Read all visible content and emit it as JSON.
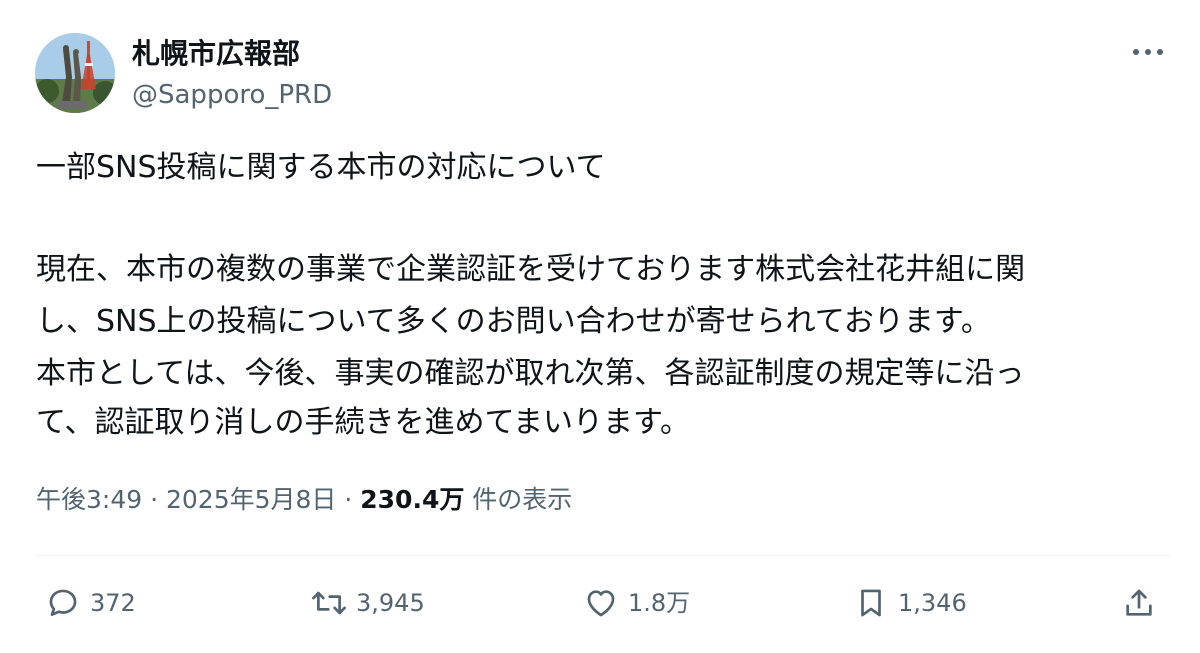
{
  "account": {
    "display_name": "札幌市広報部",
    "handle": "@Sapporo_PRD",
    "avatar_icon": "sapporo-tv-tower-statue-avatar"
  },
  "post": {
    "title_line": "一部SNS投稿に関する本市の対応について",
    "paragraph_lines": [
      "現在、本市の複数の事業で企業認証を受けております株式会社花井組に関",
      "し、SNS上の投稿について多くのお問い合わせが寄せられております。",
      "本市としては、今後、事実の確認が取れ次第、各認証制度の規定等に沿っ",
      "て、認証取り消しの手続きを進めてまいります。"
    ]
  },
  "meta": {
    "time": "午後3:49",
    "separator": " · ",
    "date": "2025年5月8日",
    "views_count": "230.4万",
    "views_label": " 件の表示"
  },
  "actions": {
    "replies": "372",
    "reposts": "3,945",
    "likes": "1.8万",
    "bookmarks": "1,346"
  },
  "colors": {
    "text_primary": "#0f1419",
    "text_secondary": "#536471",
    "divider": "#eff3f4"
  }
}
